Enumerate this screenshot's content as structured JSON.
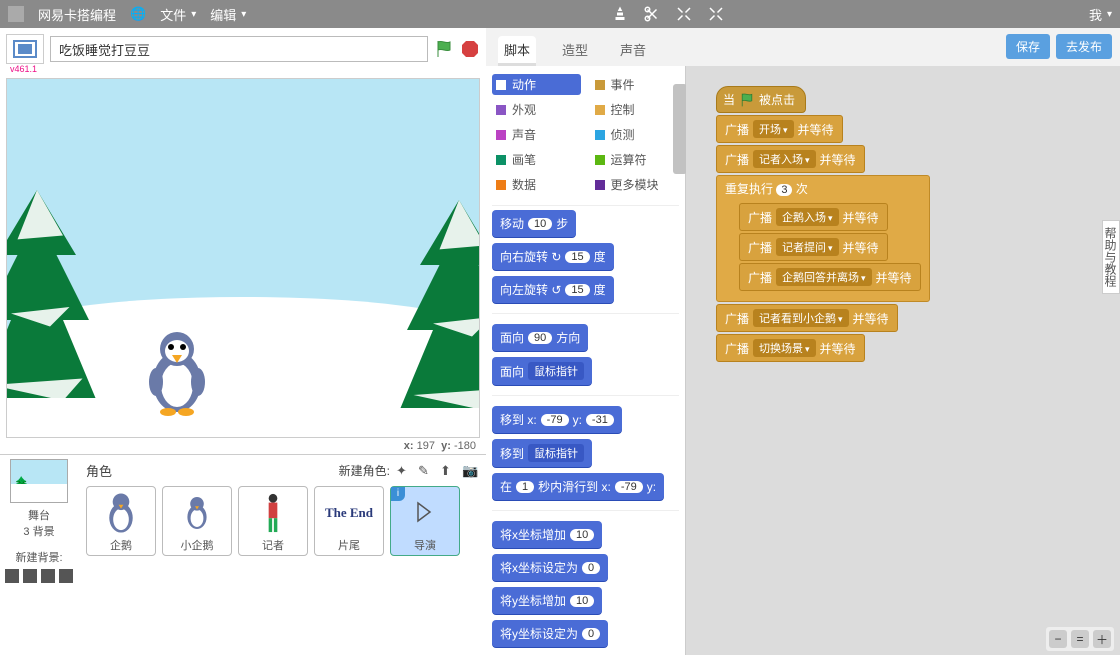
{
  "menubar": {
    "brand": "网易卡搭编程",
    "file": "文件",
    "edit": "编辑",
    "account": "我"
  },
  "project": {
    "title": "吃饭睡觉打豆豆",
    "version": "v461.1"
  },
  "stage": {
    "coord_x_label": "x:",
    "coord_x": "197",
    "coord_y_label": "y:",
    "coord_y": "-180"
  },
  "stagethumb": {
    "label": "舞台",
    "backdrops": "3 背景",
    "newbg": "新建背景:"
  },
  "sprites": {
    "header": "角色",
    "new": "新建角色:",
    "items": [
      {
        "name": "企鹅"
      },
      {
        "name": "小企鹅"
      },
      {
        "name": "记者"
      },
      {
        "name": "片尾",
        "text": "The End"
      },
      {
        "name": "导演"
      }
    ]
  },
  "tabs": {
    "scripts": "脚本",
    "costumes": "造型",
    "sounds": "声音"
  },
  "buttons": {
    "save": "保存",
    "publish": "去发布"
  },
  "categories": [
    {
      "name": "动作",
      "color": "#4a6cd6",
      "active": true
    },
    {
      "name": "事件",
      "color": "#c99a3a"
    },
    {
      "name": "外观",
      "color": "#8a56c4"
    },
    {
      "name": "控制",
      "color": "#e0aa46"
    },
    {
      "name": "声音",
      "color": "#bb42c3"
    },
    {
      "name": "侦测",
      "color": "#2ca5e2"
    },
    {
      "name": "画笔",
      "color": "#0c9166"
    },
    {
      "name": "运算符",
      "color": "#5cb712"
    },
    {
      "name": "数据",
      "color": "#ee7d16"
    },
    {
      "name": "更多模块",
      "color": "#632d99"
    }
  ],
  "palette_blocks": {
    "move": {
      "pre": "移动",
      "val": "10",
      "post": "步"
    },
    "turn_r": {
      "pre": "向右旋转 ↻",
      "val": "15",
      "post": "度"
    },
    "turn_l": {
      "pre": "向左旋转 ↺",
      "val": "15",
      "post": "度"
    },
    "point_dir": {
      "pre": "面向",
      "val": "90",
      "post": "方向"
    },
    "point_to": {
      "pre": "面向",
      "dd": "鼠标指针"
    },
    "goto_xy": {
      "pre": "移到 x:",
      "x": "-79",
      "mid": "y:",
      "y": "-31"
    },
    "goto": {
      "pre": "移到",
      "dd": "鼠标指针"
    },
    "glide": {
      "pre": "在",
      "sec": "1",
      "mid": "秒内滑行到 x:",
      "x": "-79",
      "mid2": "y:"
    },
    "dx": {
      "pre": "将x坐标增加",
      "val": "10"
    },
    "setx": {
      "pre": "将x坐标设定为",
      "val": "0"
    },
    "dy": {
      "pre": "将y坐标增加",
      "val": "10"
    },
    "sety": {
      "pre": "将y坐标设定为",
      "val": "0"
    }
  },
  "script": {
    "hat": {
      "pre": "当",
      "post": "被点击"
    },
    "b1": {
      "pre": "广播",
      "dd": "开场",
      "post": "并等待"
    },
    "b2": {
      "pre": "广播",
      "dd": "记者入场",
      "post": "并等待"
    },
    "loop": {
      "pre": "重复执行",
      "val": "3",
      "post": "次"
    },
    "l1": {
      "pre": "广播",
      "dd": "企鹅入场",
      "post": "并等待"
    },
    "l2": {
      "pre": "广播",
      "dd": "记者提问",
      "post": "并等待"
    },
    "l3": {
      "pre": "广播",
      "dd": "企鹅回答并离场",
      "post": "并等待"
    },
    "b3": {
      "pre": "广播",
      "dd": "记者看到小企鹅",
      "post": "并等待"
    },
    "b4": {
      "pre": "广播",
      "dd": "切换场景",
      "post": "并等待"
    }
  },
  "sidehelp": "帮助与教程"
}
